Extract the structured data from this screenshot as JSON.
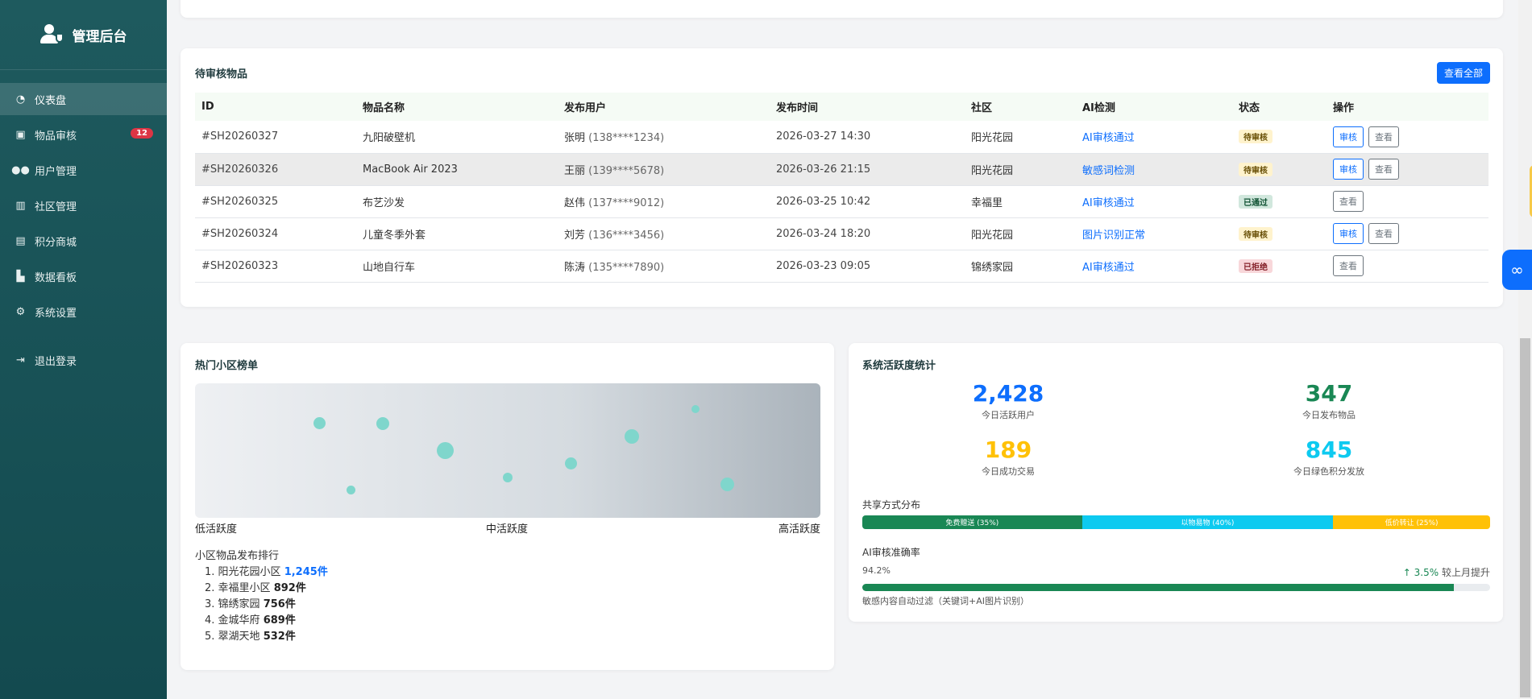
{
  "brand": {
    "title": "管理后台",
    "icon": "user-shield-icon"
  },
  "sidebar": {
    "items": [
      {
        "label": "仪表盘",
        "icon": "dashboard-icon",
        "active": true
      },
      {
        "label": "物品审核",
        "icon": "clipboard-check-icon",
        "badge": "12"
      },
      {
        "label": "用户管理",
        "icon": "users-icon"
      },
      {
        "label": "社区管理",
        "icon": "building-icon"
      },
      {
        "label": "积分商城",
        "icon": "gift-icon"
      },
      {
        "label": "数据看板",
        "icon": "chart-icon"
      },
      {
        "label": "系统设置",
        "icon": "gear-icon"
      },
      {
        "label": "退出登录",
        "icon": "logout-icon"
      }
    ]
  },
  "review": {
    "title": "待审核物品",
    "view_all": "查看全部",
    "columns": [
      "ID",
      "物品名称",
      "发布用户",
      "发布时间",
      "社区",
      "AI检测",
      "状态",
      "操作"
    ],
    "rows": [
      {
        "id": "#SH20260327",
        "name": "九阳破壁机",
        "user": "张明",
        "phone": "(138****1234)",
        "time": "2026-03-27 14:30",
        "community": "阳光花园",
        "ai": "AI审核通过",
        "status": "待审核",
        "status_type": "pending",
        "actions": [
          "审核",
          "查看"
        ]
      },
      {
        "id": "#SH20260326",
        "name": "MacBook Air 2023",
        "user": "王丽",
        "phone": "(139****5678)",
        "time": "2026-03-26 21:15",
        "community": "阳光花园",
        "ai": "敏感词检测",
        "status": "待审核",
        "status_type": "pending",
        "actions": [
          "审核",
          "查看"
        ]
      },
      {
        "id": "#SH20260325",
        "name": "布艺沙发",
        "user": "赵伟",
        "phone": "(137****9012)",
        "time": "2026-03-25 10:42",
        "community": "幸福里",
        "ai": "AI审核通过",
        "status": "已通过",
        "status_type": "pass",
        "actions": [
          "查看"
        ]
      },
      {
        "id": "#SH20260324",
        "name": "儿童冬季外套",
        "user": "刘芳",
        "phone": "(136****3456)",
        "time": "2026-03-24 18:20",
        "community": "阳光花园",
        "ai": "图片识别正常",
        "status": "待审核",
        "status_type": "pending",
        "actions": [
          "审核",
          "查看"
        ]
      },
      {
        "id": "#SH20260323",
        "name": "山地自行车",
        "user": "陈涛",
        "phone": "(135****7890)",
        "time": "2026-03-23 09:05",
        "community": "锦绣家园",
        "ai": "AI审核通过",
        "status": "已拒绝",
        "status_type": "reject",
        "actions": [
          "查看"
        ]
      }
    ]
  },
  "hot": {
    "title": "热门小区榜单",
    "axis": {
      "low": "低活跃度",
      "mid": "中活跃度",
      "high": "高活跃度"
    },
    "rank_title": "小区物品发布排行",
    "ranks": [
      {
        "no": "1.",
        "name": "阳光花园小区",
        "count": "1,245件"
      },
      {
        "no": "2.",
        "name": "幸福里小区",
        "count": "892件"
      },
      {
        "no": "3.",
        "name": "锦绣家园",
        "count": "756件"
      },
      {
        "no": "4.",
        "name": "金城华府",
        "count": "689件"
      },
      {
        "no": "5.",
        "name": "翠湖天地",
        "count": "532件"
      }
    ]
  },
  "stats": {
    "title": "系统活跃度统计",
    "items": [
      {
        "value": "2,428",
        "label": "今日活跃用户",
        "color": "#0d6efd"
      },
      {
        "value": "347",
        "label": "今日发布物品",
        "color": "#198754"
      },
      {
        "value": "189",
        "label": "今日成功交易",
        "color": "#ffc107"
      },
      {
        "value": "845",
        "label": "今日绿色积分发放",
        "color": "#0dcaf0"
      }
    ],
    "share_title": "共享方式分布",
    "share": [
      {
        "label": "免费赠送 (35%)",
        "pct": 35,
        "color": "#198754"
      },
      {
        "label": "以物易物 (40%)",
        "pct": 40,
        "color": "#0dcaf0"
      },
      {
        "label": "低价转让 (25%)",
        "pct": 25,
        "color": "#ffc107"
      }
    ],
    "acc_title": "AI审核准确率",
    "acc_value": "94.2%",
    "acc_pct": 94.2,
    "acc_up": "3.5%",
    "acc_up_text": "较上月提升",
    "note": "敏感内容自动过滤（关键词+AI图片识别）"
  }
}
